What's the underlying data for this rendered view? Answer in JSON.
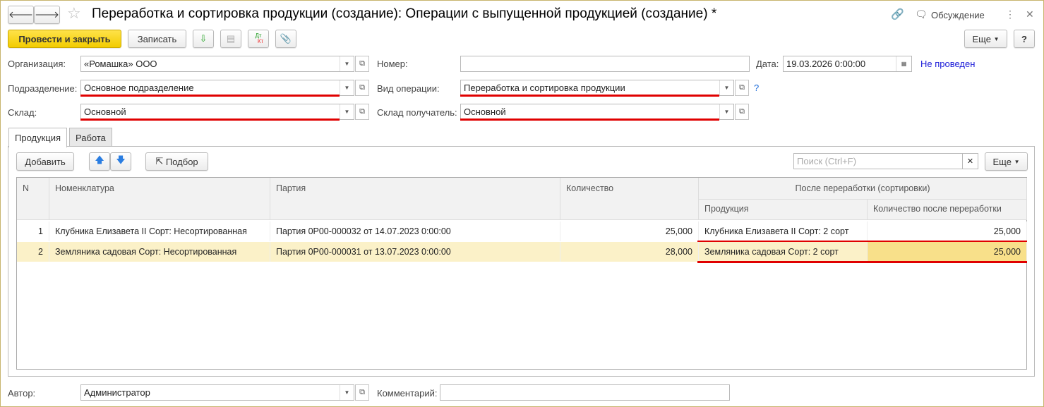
{
  "window": {
    "title": "Переработка и сортировка продукции (создание): Операции с выпущенной продукцией (создание) *",
    "discussion": "Обсуждение"
  },
  "toolbar": {
    "post_close": "Провести и закрыть",
    "save": "Записать",
    "more": "Еще",
    "help": "?",
    "dtkt_top": "Дт",
    "dtkt_bottom": "Кт"
  },
  "form": {
    "org_label": "Организация:",
    "org_value": "«Ромашка» ООО",
    "number_label": "Номер:",
    "number_value": "",
    "date_label": "Дата:",
    "date_value": "19.03.2026  0:00:00",
    "status": "Не проведен",
    "dept_label": "Подразделение:",
    "dept_value": "Основное подразделение",
    "op_label": "Вид операции:",
    "op_value": "Переработка и сортировка продукции",
    "op_help": "?",
    "wh_label": "Склад:",
    "wh_value": "Основной",
    "wh2_label": "Склад получатель:",
    "wh2_value": "Основной",
    "author_label": "Автор:",
    "author_value": "Администратор",
    "comment_label": "Комментарий:",
    "comment_value": ""
  },
  "tabs": [
    {
      "label": "Продукция"
    },
    {
      "label": "Работа"
    }
  ],
  "table_toolbar": {
    "add": "Добавить",
    "pick": "Подбор",
    "search_placeholder": "Поиск (Ctrl+F)",
    "more": "Еще"
  },
  "table": {
    "headers": {
      "n": "N",
      "item": "Номенклатура",
      "batch": "Партия",
      "qty": "Количество",
      "after": "После переработки (сортировки)",
      "product": "Продукция",
      "qty_after": "Количество после переработки"
    },
    "rows": [
      {
        "n": "1",
        "item": "Клубника Елизавета II Сорт: Несортированная",
        "batch": "Партия 0Р00-000032 от 14.07.2023 0:00:00",
        "qty": "25,000",
        "product": "Клубника Елизавета II Сорт: 2 сорт",
        "qty_after": "25,000"
      },
      {
        "n": "2",
        "item": "Земляника садовая Сорт: Несортированная",
        "batch": "Партия 0Р00-000031 от 13.07.2023 0:00:00",
        "qty": "28,000",
        "product": "Земляника садовая Сорт: 2 сорт",
        "qty_after": "25,000"
      }
    ]
  }
}
